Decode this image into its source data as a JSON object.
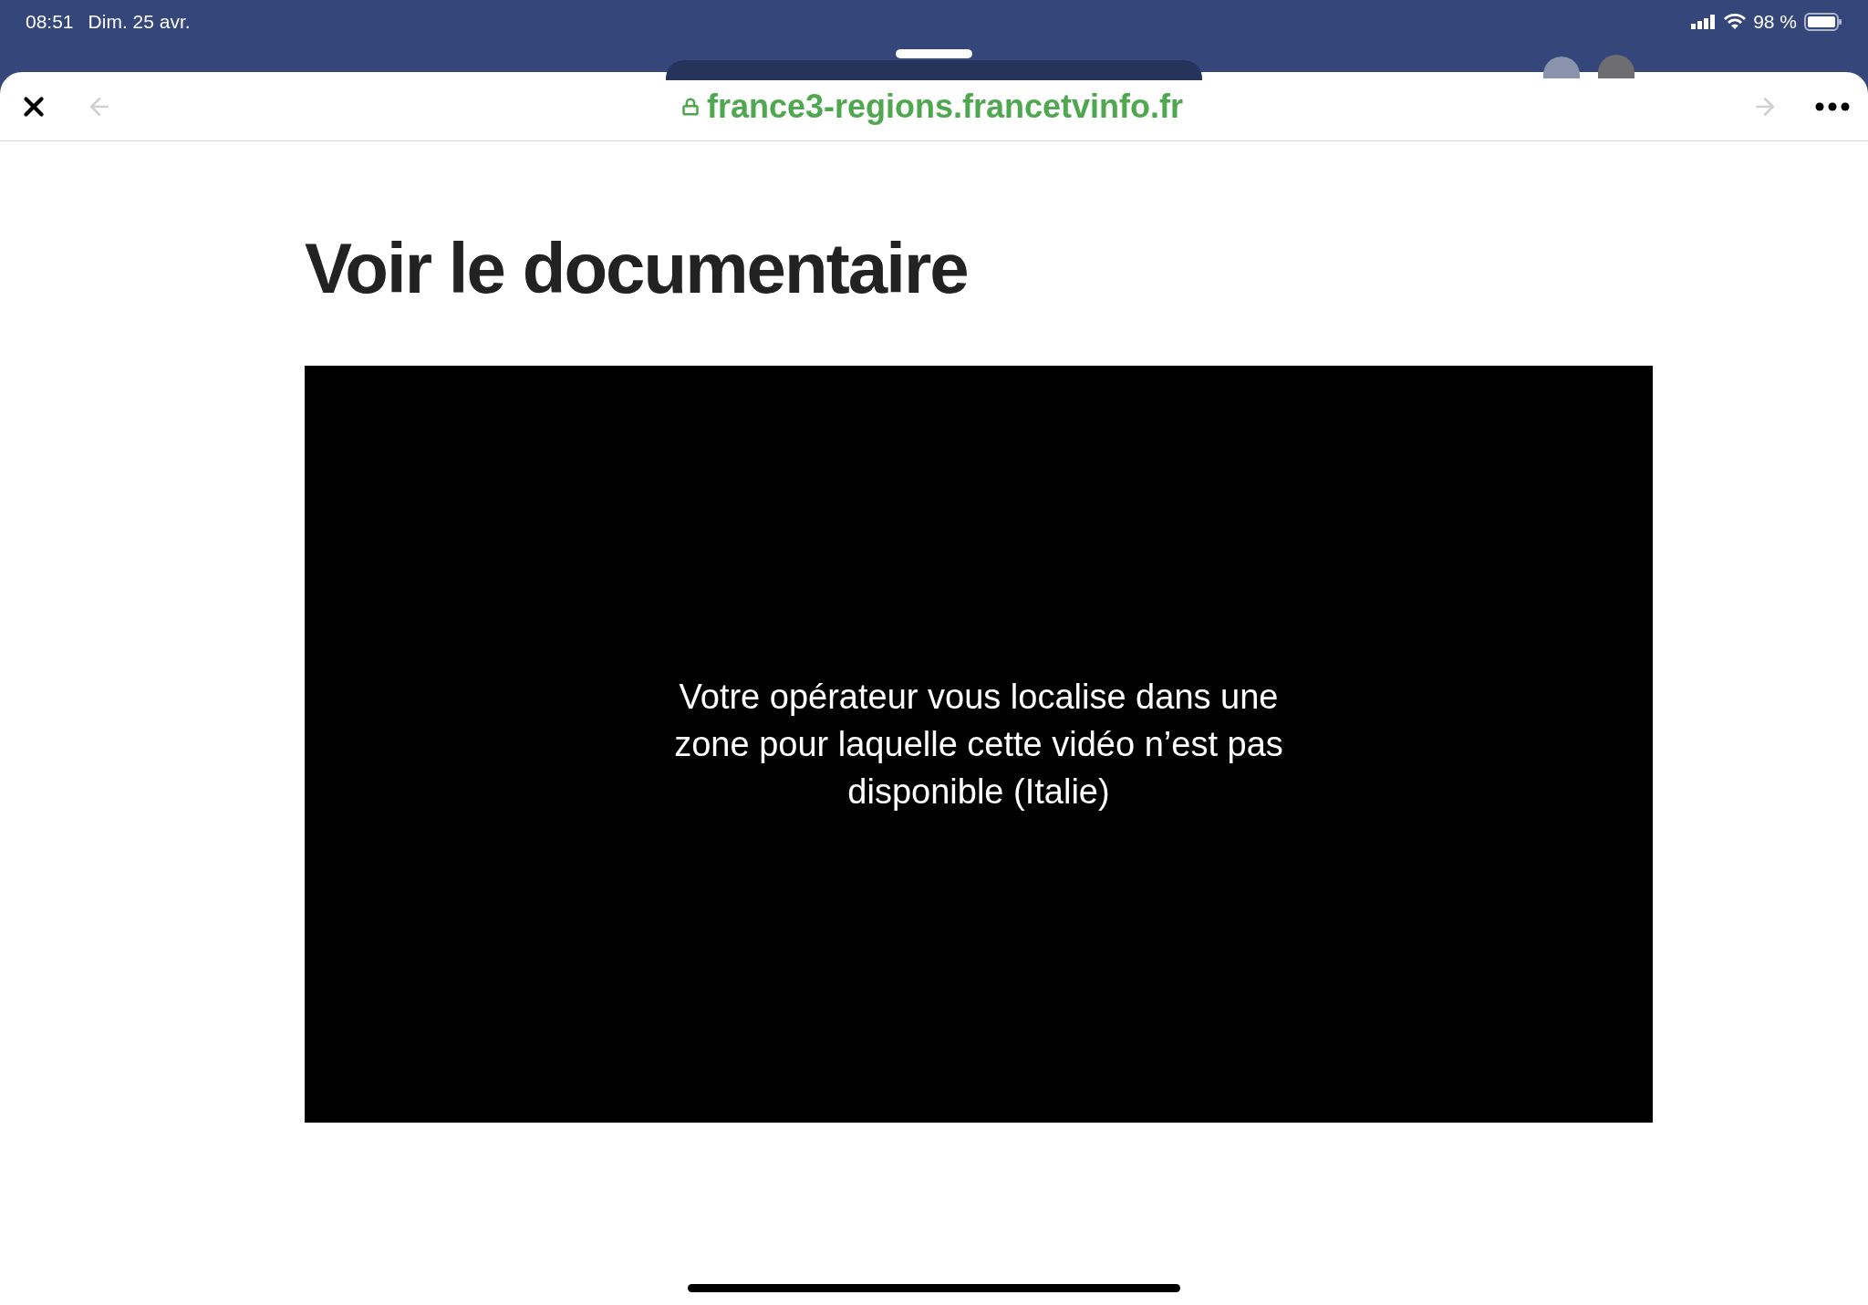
{
  "status_bar": {
    "time": "08:51",
    "date": "Dim. 25 avr.",
    "battery": "98 %"
  },
  "browser": {
    "url": "france3-regions.francetvinfo.fr",
    "back_disabled": true,
    "forward_disabled": true
  },
  "heading": "Voir le documentaire",
  "video": {
    "message": "Votre opérateur vous localise dans une zone pour laquelle cette vidéo n’est pas disponible (Italie)"
  }
}
